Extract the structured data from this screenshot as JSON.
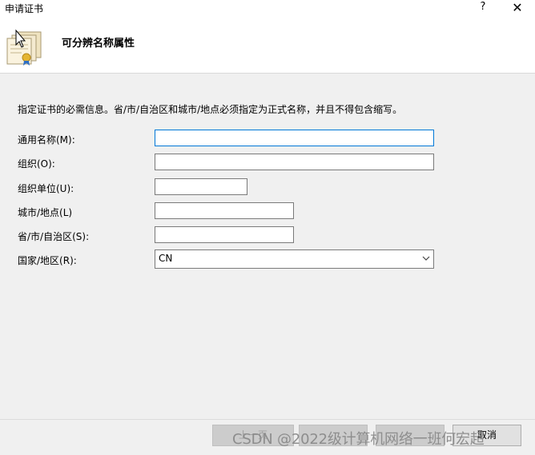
{
  "window": {
    "title": "申请证书",
    "help_label": "?",
    "close_label": "✕"
  },
  "header": {
    "icon": "certificate-icon",
    "title": "可分辨名称属性"
  },
  "description": "指定证书的必需信息。省/市/自治区和城市/地点必须指定为正式名称，并且不得包含缩写。",
  "form": {
    "common_name": {
      "label": "通用名称(M):",
      "value": ""
    },
    "organization": {
      "label": "组织(O):",
      "value": ""
    },
    "org_unit": {
      "label": "组织单位(U):",
      "value": ""
    },
    "city": {
      "label": "城市/地点(L)",
      "value": ""
    },
    "state": {
      "label": "省/市/自治区(S):",
      "value": ""
    },
    "country": {
      "label": "国家/地区(R):",
      "value": "CN"
    }
  },
  "footer": {
    "previous_label": "上一页",
    "next_label": "",
    "finish_label": "",
    "cancel_label": "取消"
  },
  "watermark": "CSDN @2022级计算机网络一班何宏超"
}
